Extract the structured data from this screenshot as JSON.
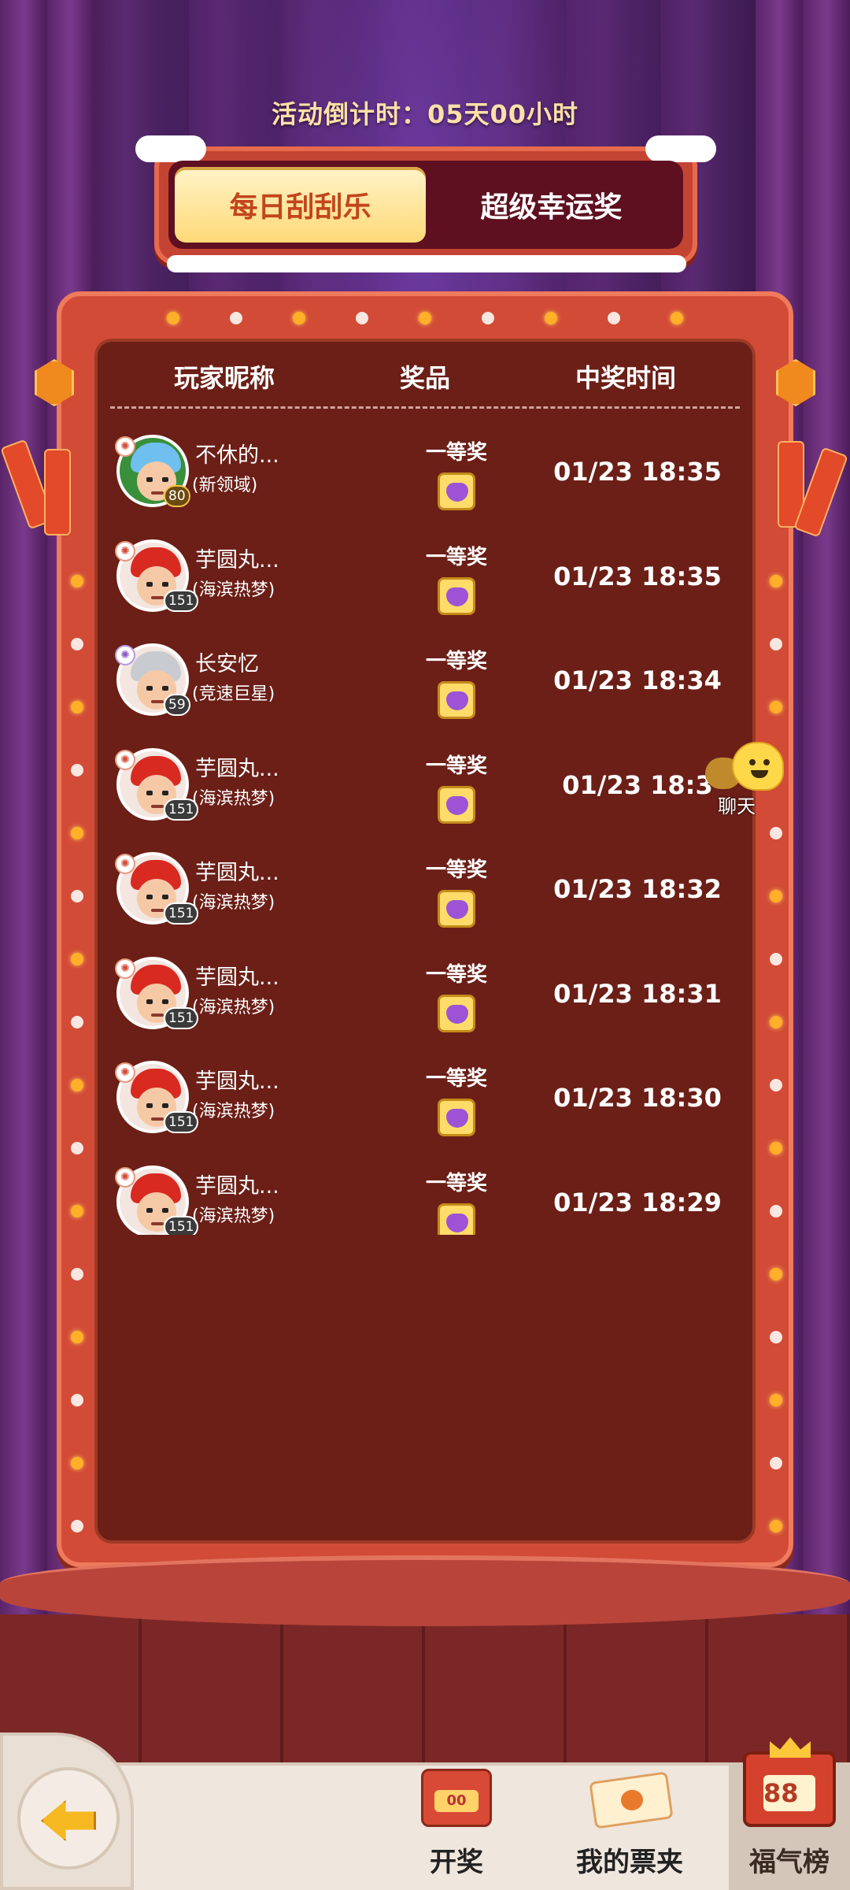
{
  "countdown": {
    "text": "活动倒计时：05天00小时"
  },
  "tabs": [
    {
      "label": "每日刮刮乐",
      "active": true
    },
    {
      "label": "超级幸运奖",
      "active": false
    }
  ],
  "table": {
    "headers": [
      "玩家昵称",
      "奖品",
      "中奖时间"
    ],
    "rows": [
      {
        "name": "不休的...",
        "server": "(新领域)",
        "level": "80",
        "prize": "一等奖",
        "time": "01/23 18:35",
        "avatar": "blue-hair-avatar"
      },
      {
        "name": "芋圆丸...",
        "server": "(海滨热梦)",
        "level": "151",
        "prize": "一等奖",
        "time": "01/23 18:35",
        "avatar": "red-hair-avatar"
      },
      {
        "name": "长安忆",
        "server": "(竞速巨星)",
        "level": "59",
        "prize": "一等奖",
        "time": "01/23 18:34",
        "avatar": "silver-hair-avatar"
      },
      {
        "name": "芋圆丸...",
        "server": "(海滨热梦)",
        "level": "151",
        "prize": "一等奖",
        "time": "01/23 18:3",
        "avatar": "red-hair-avatar"
      },
      {
        "name": "芋圆丸...",
        "server": "(海滨热梦)",
        "level": "151",
        "prize": "一等奖",
        "time": "01/23 18:32",
        "avatar": "red-hair-avatar"
      },
      {
        "name": "芋圆丸...",
        "server": "(海滨热梦)",
        "level": "151",
        "prize": "一等奖",
        "time": "01/23 18:31",
        "avatar": "red-hair-avatar"
      },
      {
        "name": "芋圆丸...",
        "server": "(海滨热梦)",
        "level": "151",
        "prize": "一等奖",
        "time": "01/23 18:30",
        "avatar": "red-hair-avatar"
      },
      {
        "name": "芋圆丸...",
        "server": "(海滨热梦)",
        "level": "151",
        "prize": "一等奖",
        "time": "01/23 18:29",
        "avatar": "red-hair-avatar"
      }
    ]
  },
  "chat": {
    "label": "聊天"
  },
  "bottom_nav": {
    "lottery_label": "开奖",
    "lottery_icon_text": "00",
    "ticket_label": "我的票夹",
    "fuqi_label": "福气榜",
    "fuqi_icon_text": "88"
  },
  "colors": {
    "frame": "#d24b37",
    "panel": "#6b1f17",
    "tab_active_text": "#c2451c",
    "bulb": "#ffb028"
  }
}
